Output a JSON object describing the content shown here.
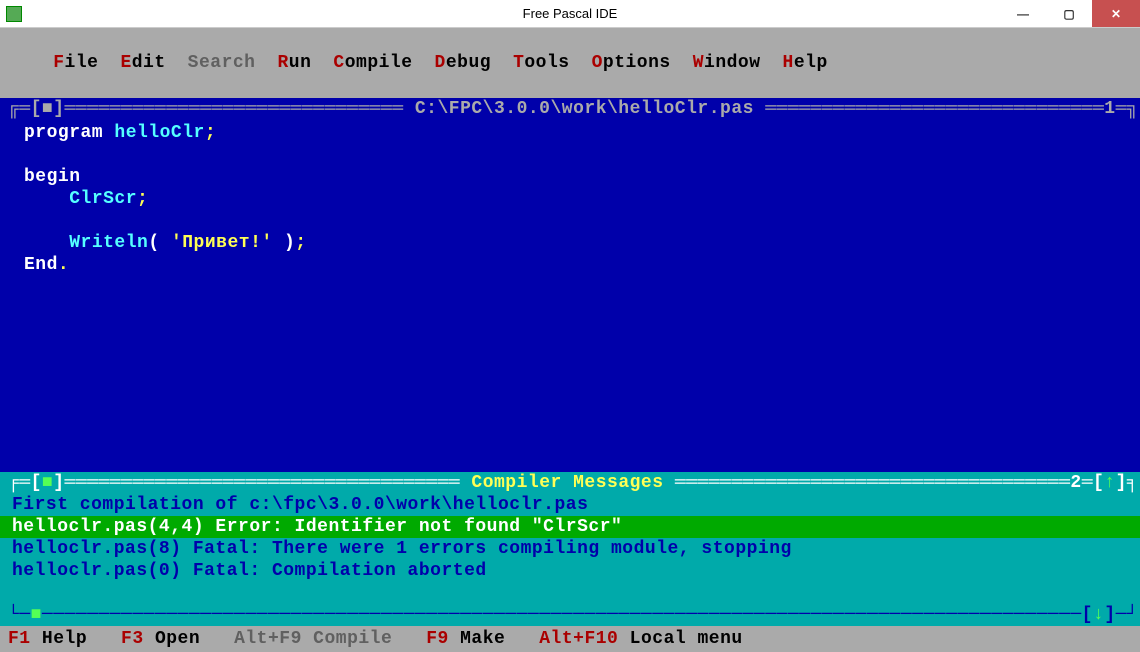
{
  "window": {
    "title": "Free Pascal IDE"
  },
  "menu": {
    "items": [
      {
        "hot": "F",
        "rest": "ile"
      },
      {
        "hot": "E",
        "rest": "dit"
      },
      {
        "hot": "S",
        "rest": "earch",
        "dim": true
      },
      {
        "hot": "R",
        "rest": "un"
      },
      {
        "hot": "C",
        "rest": "ompile"
      },
      {
        "hot": "D",
        "rest": "ebug"
      },
      {
        "hot": "T",
        "rest": "ools"
      },
      {
        "hot": "O",
        "rest": "ptions"
      },
      {
        "hot": "W",
        "rest": "indow"
      },
      {
        "hot": "H",
        "rest": "elp"
      }
    ]
  },
  "editor": {
    "window_number": "1",
    "title": "C:\\FPC\\3.0.0\\work\\helloClr.pas",
    "lines": [
      [
        {
          "c": "kw",
          "t": "program "
        },
        {
          "c": "ident",
          "t": "helloClr"
        },
        {
          "c": "semi",
          "t": ";"
        }
      ],
      [],
      [
        {
          "c": "kw",
          "t": "begin"
        }
      ],
      [
        {
          "c": "",
          "t": "    "
        },
        {
          "c": "call",
          "t": "ClrScr"
        },
        {
          "c": "semi",
          "t": ";"
        }
      ],
      [],
      [
        {
          "c": "",
          "t": "    "
        },
        {
          "c": "call",
          "t": "Writeln"
        },
        {
          "c": "kw",
          "t": "( "
        },
        {
          "c": "str",
          "t": "'Привет!'"
        },
        {
          "c": "kw",
          "t": " )"
        },
        {
          "c": "semi",
          "t": ";"
        }
      ],
      [
        {
          "c": "kw",
          "t": "End"
        },
        {
          "c": "semi",
          "t": "."
        }
      ]
    ]
  },
  "compiler": {
    "title": "Compiler Messages",
    "window_number": "2",
    "messages": [
      {
        "text": "First compilation of c:\\fpc\\3.0.0\\work\\helloclr.pas",
        "type": "info"
      },
      {
        "text": "helloclr.pas(4,4) Error: Identifier not found \"ClrScr\"",
        "type": "error"
      },
      {
        "text": "helloclr.pas(8) Fatal: There were 1 errors compiling module, stopping",
        "type": "info"
      },
      {
        "text": "helloclr.pas(0) Fatal: Compilation aborted",
        "type": "info"
      }
    ]
  },
  "status": {
    "items": [
      {
        "key": "F1",
        "label": "Help"
      },
      {
        "key": "F3",
        "label": "Open"
      },
      {
        "key": "Alt+F9",
        "label": "Compile",
        "dim": true
      },
      {
        "key": "F9",
        "label": "Make"
      },
      {
        "key": "Alt+F10",
        "label": "Local menu"
      }
    ]
  }
}
